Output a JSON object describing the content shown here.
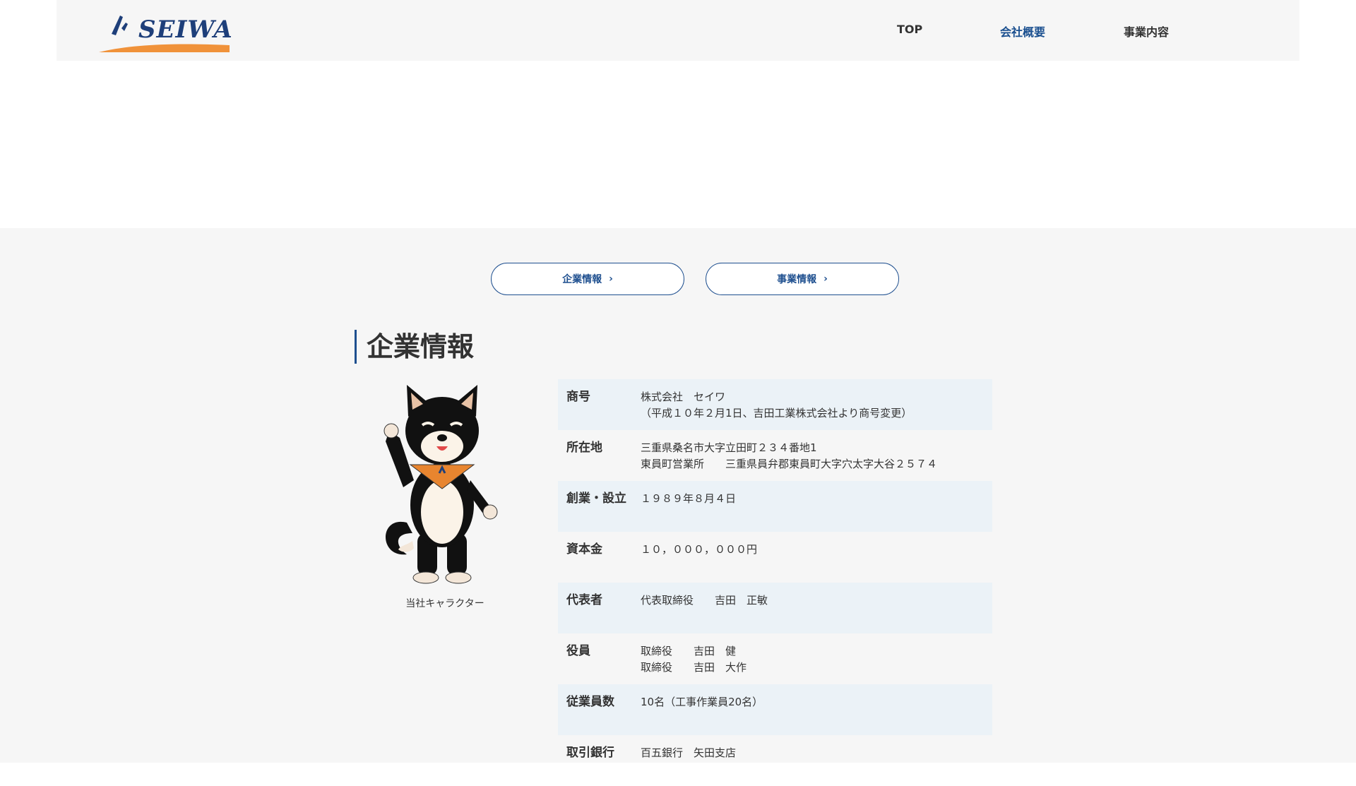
{
  "header": {
    "logo_text": "SEIWA",
    "nav": [
      {
        "label": "TOP",
        "active": false
      },
      {
        "label": "会社概要",
        "active": true
      },
      {
        "label": "事業内容",
        "active": false
      }
    ]
  },
  "buttons": {
    "company_info": "企業情報",
    "business_info": "事業情報"
  },
  "section": {
    "title": "企業情報",
    "mascot_caption": "当社キャラクター"
  },
  "company_table": [
    {
      "label": "商号",
      "value": "株式会社　セイワ\n（平成１０年２月1日、吉田工業株式会社より商号変更）"
    },
    {
      "label": "所在地",
      "value": "三重県桑名市大字立田町２３４番地1\n東員町営業所　　三重県員弁郡東員町大字穴太字大谷２５７４"
    },
    {
      "label": "創業・設立",
      "value": "１９８９年８月４日"
    },
    {
      "label": "資本金",
      "value": "１０，０００，０００円"
    },
    {
      "label": "代表者",
      "value": "代表取締役　　吉田　正敏"
    },
    {
      "label": "役員",
      "value": "取締役　　吉田　健\n取締役　　吉田　大作"
    },
    {
      "label": "従業員数",
      "value": "10名（工事作業員20名）"
    },
    {
      "label": "取引銀行",
      "value": "百五銀行　矢田支店"
    }
  ],
  "colors": {
    "accent": "#1e4f8f",
    "header_bg": "#f6f6f6",
    "row_shade": "#ebf2f7",
    "logo_orange": "#f0923a"
  }
}
